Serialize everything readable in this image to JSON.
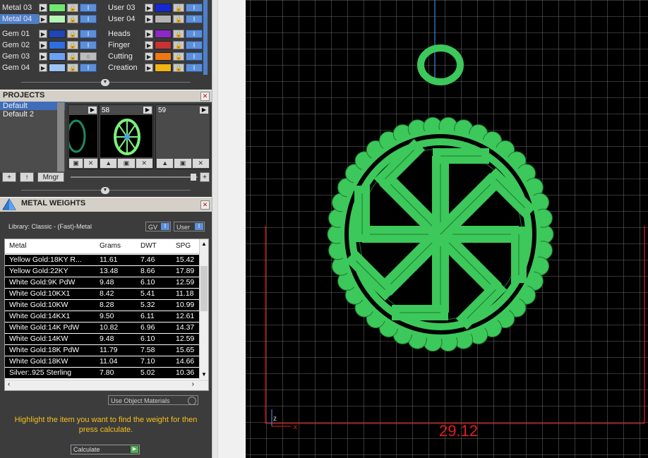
{
  "materials": {
    "left": [
      {
        "label": "Metal 03",
        "color": "#6ee86e",
        "selected": false
      },
      {
        "label": "Metal 04",
        "color": "#b4f4b4",
        "selected": true
      },
      {
        "label": "Gem 01",
        "color": "#1e46b4",
        "selected": false
      },
      {
        "label": "Gem 02",
        "color": "#2e6ee0",
        "selected": false
      },
      {
        "label": "Gem 03",
        "color": "#6aa2f0",
        "selected": false
      },
      {
        "label": "Gem 04",
        "color": "#9cc4f6",
        "selected": false
      }
    ],
    "right": [
      {
        "label": "User 03",
        "color": "#1428d8"
      },
      {
        "label": "User 04",
        "color": "#b4b4b4"
      },
      {
        "label": "Heads",
        "color": "#8c28c8"
      },
      {
        "label": "Finger",
        "color": "#c83232"
      },
      {
        "label": "Cutting",
        "color": "#f07814"
      },
      {
        "label": "Creation",
        "color": "#f0b414"
      }
    ]
  },
  "projects": {
    "title": "PROJECTS",
    "items": [
      "Default",
      "Default 2"
    ],
    "selected": "Default",
    "thumbs": [
      {
        "num": ""
      },
      {
        "num": "58"
      },
      {
        "num": "59"
      }
    ],
    "manager_label": "Mngr",
    "add_label": "+",
    "up_label": "↑",
    "add_right": "+"
  },
  "weights": {
    "title": "METAL WEIGHTS",
    "library": "Library: Classic - (Fast)-Metal",
    "gv_label": "GV",
    "user_label": "User",
    "columns": [
      "Metal",
      "Grams",
      "DWT",
      "SPG"
    ],
    "rows": [
      [
        "Yellow Gold:18KY R...",
        "11.61",
        "7.46",
        "15.42"
      ],
      [
        "Yellow Gold:22KY",
        "13.48",
        "8.66",
        "17.89"
      ],
      [
        "White Gold:9K PdW",
        "9.48",
        "6.10",
        "12.59"
      ],
      [
        "White Gold:10KX1",
        "8.42",
        "5.41",
        "11.18"
      ],
      [
        "White Gold:10KW",
        "8.28",
        "5.32",
        "10.99"
      ],
      [
        "White Gold:14KX1",
        "9.50",
        "6.11",
        "12.61"
      ],
      [
        "White Gold:14K PdW",
        "10.82",
        "6.96",
        "14.37"
      ],
      [
        "White Gold:14KW",
        "9.48",
        "6.10",
        "12.59"
      ],
      [
        "White Gold:18K PdW",
        "11.79",
        "7.58",
        "15.65"
      ],
      [
        "White Gold:18KW",
        "11.04",
        "7.10",
        "14.66"
      ],
      [
        "Silver:.925 Sterling",
        "7.80",
        "5.02",
        "10.36"
      ]
    ],
    "use_object": "Use Object Materials",
    "hint": "Highlight the item you want to find the weight for then press calculate.",
    "calculate": "Calculate"
  },
  "viewport": {
    "dimension": "29.12",
    "axis_z": "z",
    "axis_x": "x",
    "model_color": "#3cc85a"
  }
}
